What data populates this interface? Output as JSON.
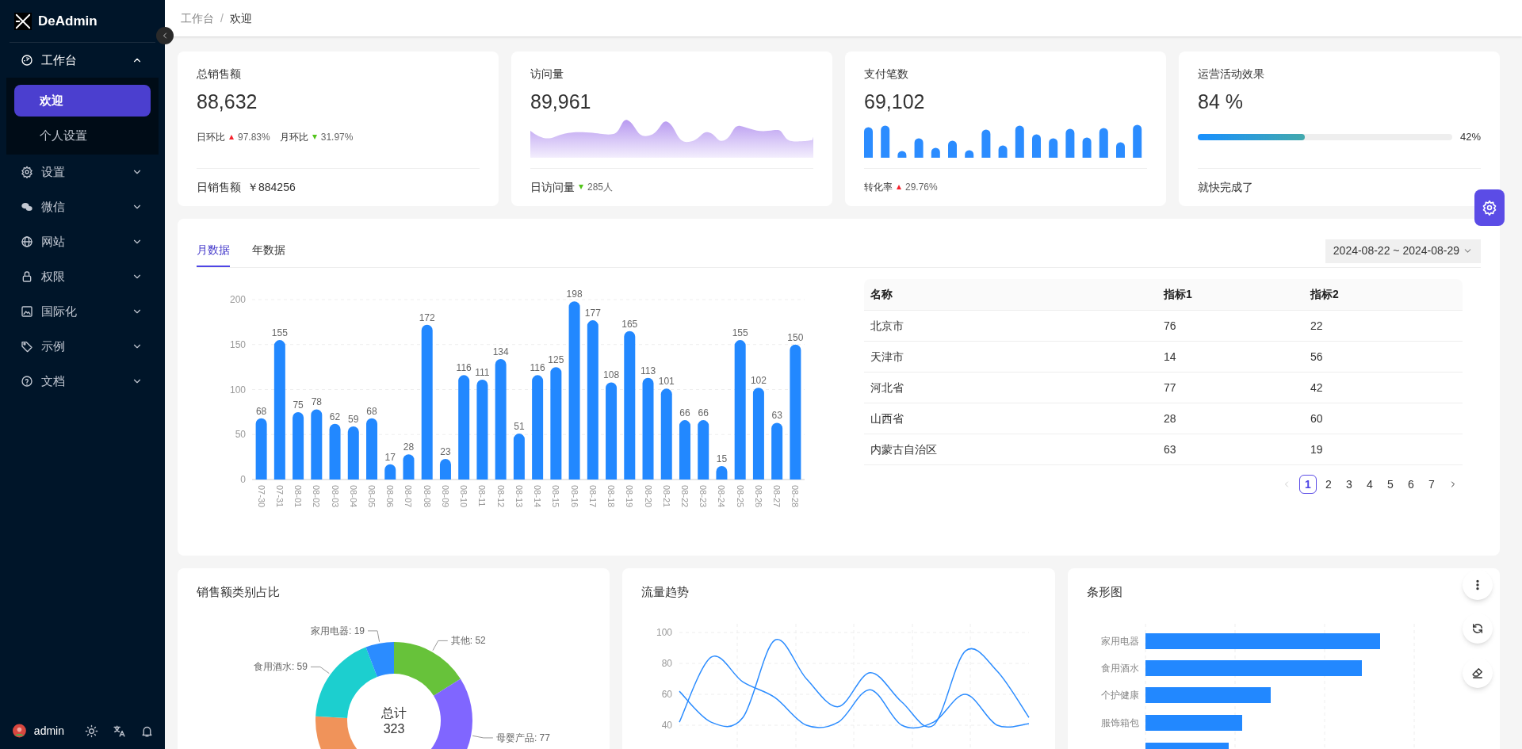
{
  "sidebar": {
    "logo": "DeAdmin",
    "menu": [
      {
        "label": "工作台",
        "expanded": true,
        "children": [
          {
            "label": "欢迎",
            "selected": true
          },
          {
            "label": "个人设置",
            "selected": false
          }
        ]
      },
      {
        "label": "设置",
        "expanded": false
      },
      {
        "label": "微信",
        "expanded": false
      },
      {
        "label": "网站",
        "expanded": false
      },
      {
        "label": "权限",
        "expanded": false
      },
      {
        "label": "国际化",
        "expanded": false
      },
      {
        "label": "示例",
        "expanded": false
      },
      {
        "label": "文档",
        "expanded": false
      }
    ],
    "user": "admin"
  },
  "breadcrumb": {
    "items": [
      "工作台",
      "欢迎"
    ],
    "separator": "/"
  },
  "cards": [
    {
      "kind": "stats",
      "title": "总销售额",
      "value": "88,632",
      "stats": [
        {
          "label": "日环比",
          "rising": true,
          "value": "97.83%"
        },
        {
          "label": "月环比",
          "rising": false,
          "value": "31.97%"
        }
      ],
      "footer": {
        "label": "日销售额",
        "value": "￥884256"
      }
    },
    {
      "kind": "sparkline",
      "title": "访问量",
      "value": "89,961",
      "footer": {
        "label": "日访问量",
        "rising": false,
        "value": "285人"
      }
    },
    {
      "kind": "mini_bars",
      "title": "支付笔数",
      "value": "69,102",
      "footer": {
        "label": "转化率",
        "rising": true,
        "value": "29.76%"
      }
    },
    {
      "kind": "progress",
      "title": "运营活动效果",
      "value": "84 %",
      "level": 0.42,
      "reading": "42%",
      "footer": {
        "label": "就快完成了"
      }
    }
  ],
  "main_panel": {
    "tabs": [
      {
        "label": "月数据",
        "selected": true
      },
      {
        "label": "年数据",
        "selected": false
      }
    ],
    "date_range": "2024-08-22 ~ 2024-08-29",
    "chart_data": {
      "type": "bar",
      "categories": [
        "07-30",
        "07-31",
        "08-01",
        "08-02",
        "08-03",
        "08-04",
        "08-05",
        "08-06",
        "08-07",
        "08-08",
        "08-09",
        "08-10",
        "08-11",
        "08-12",
        "08-13",
        "08-14",
        "08-15",
        "08-16",
        "08-17",
        "08-18",
        "08-19",
        "08-20",
        "08-21",
        "08-22",
        "08-23",
        "08-24",
        "08-25",
        "08-26",
        "08-27",
        "08-28"
      ],
      "values": [
        68,
        155,
        75,
        78,
        62,
        59,
        68,
        17,
        28,
        172,
        23,
        116,
        111,
        134,
        51,
        116,
        125,
        198,
        177,
        108,
        165,
        113,
        101,
        66,
        66,
        15,
        155,
        102,
        63,
        150
      ],
      "yticks": [
        0,
        50,
        100,
        150,
        200
      ],
      "ylim": [
        0,
        200
      ],
      "grid": true,
      "data_labels": true
    },
    "table": {
      "columns": [
        "名称",
        "指标1",
        "指标2"
      ],
      "rows": [
        [
          "北京市",
          "76",
          "22"
        ],
        [
          "天津市",
          "14",
          "56"
        ],
        [
          "河北省",
          "77",
          "42"
        ],
        [
          "山西省",
          "28",
          "60"
        ],
        [
          "内蒙古自治区",
          "63",
          "19"
        ]
      ]
    },
    "pagination": {
      "prev_disabled": true,
      "next_disabled": false,
      "pages": [
        {
          "label": "1",
          "selected": true
        },
        {
          "label": "2",
          "selected": false
        },
        {
          "label": "3",
          "selected": false
        },
        {
          "label": "4",
          "selected": false
        },
        {
          "label": "5",
          "selected": false
        },
        {
          "label": "6",
          "selected": false
        },
        {
          "label": "7",
          "selected": false
        }
      ]
    }
  },
  "bottom_panels": [
    {
      "kind": "donut",
      "title": "销售额类别占比",
      "center_label": "总计",
      "center_value": "323",
      "slice_labels": [
        "其他: 52",
        "母婴产品: 77",
        "食用酒水: 59",
        "家用电器: 19"
      ]
    },
    {
      "kind": "line",
      "title": "流量趋势",
      "chart_data": {
        "type": "line",
        "yticks": [
          40,
          60,
          80,
          100
        ],
        "ylim": [
          40,
          100
        ],
        "grid": true,
        "series": [
          {
            "values": [
              62,
              42,
              45,
              95,
              70,
              52,
              74,
              55,
              40,
              88,
              75,
              45
            ]
          },
          {
            "values": [
              42,
              84,
              68,
              58,
              40,
              42,
              63,
              40,
              42,
              60,
              40,
              41
            ]
          }
        ]
      }
    },
    {
      "kind": "hbar",
      "title": "条形图",
      "bar_labels": [
        "家用电器",
        "食用酒水",
        "个护健康",
        "服饰箱包"
      ]
    }
  ]
}
